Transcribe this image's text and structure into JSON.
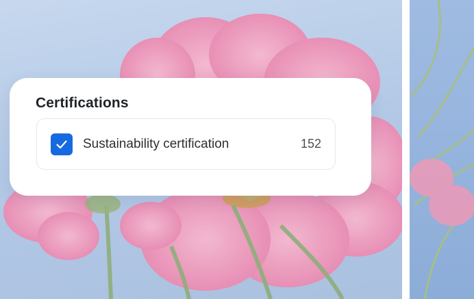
{
  "filter_card": {
    "title": "Certifications",
    "options": [
      {
        "label": "Sustainability certification",
        "count": "152",
        "checked": true,
        "check_icon": "checkmark-icon"
      }
    ]
  },
  "colors": {
    "checkbox_accent": "#1769e0",
    "card_background": "#ffffff",
    "background_sky": "#b3c9e6",
    "flower_petal": "#ec8fb4"
  }
}
